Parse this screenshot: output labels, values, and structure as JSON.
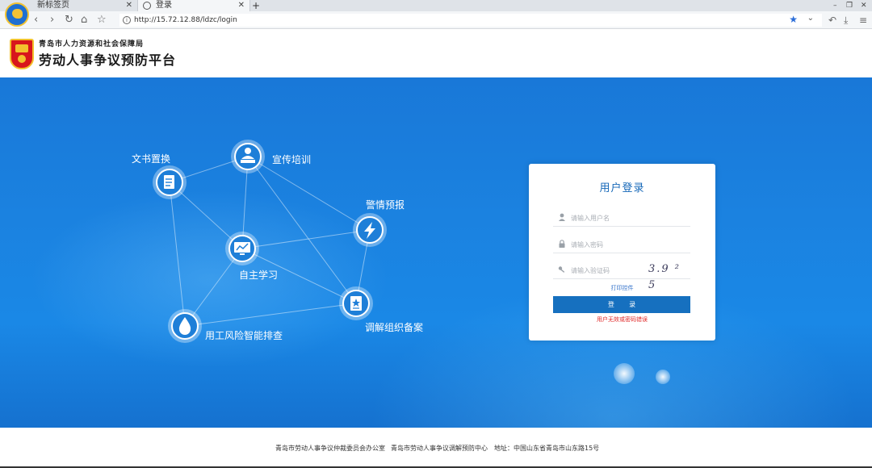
{
  "browser": {
    "tabs": [
      {
        "label": "新标签页"
      },
      {
        "label": "登录"
      }
    ],
    "new_tab": "+",
    "close": "✕",
    "url": "http://15.72.12.88/ldzc/login",
    "window_controls": {
      "minimize": "–",
      "restore": "❐",
      "close": "✕"
    }
  },
  "header": {
    "org_name": "青岛市人力资源和社会保障局",
    "platform_name": "劳动人事争议预防平台"
  },
  "network": {
    "nodes": [
      {
        "label": "文书置换",
        "icon": "document-icon"
      },
      {
        "label": "宣传培训",
        "icon": "presenter-icon"
      },
      {
        "label": "警情预报",
        "icon": "lightning-icon"
      },
      {
        "label": "自主学习",
        "icon": "monitor-chart-icon"
      },
      {
        "label": "调解组织备案",
        "icon": "star-document-icon"
      },
      {
        "label": "用工风险智能排查",
        "icon": "water-drop-icon"
      }
    ]
  },
  "login": {
    "title": "用户登录",
    "username_placeholder": "请输入用户名",
    "password_placeholder": "请输入密码",
    "captcha_placeholder": "请输入验证码",
    "captcha_text": "3.9 ² 5",
    "print_link": "打印控件",
    "submit_label": "登 录",
    "error": "用户无效或密码错误"
  },
  "footer": {
    "office": "青岛市劳动人事争议仲裁委员会办公室",
    "center": "青岛市劳动人事争议调解预防中心",
    "address": "地址：中国山东省青岛市山东路15号"
  },
  "colors": {
    "banner_blue": "#1a82e0",
    "button_blue": "#1670bf",
    "title_blue": "#1467b8",
    "error_red": "#e02828"
  }
}
